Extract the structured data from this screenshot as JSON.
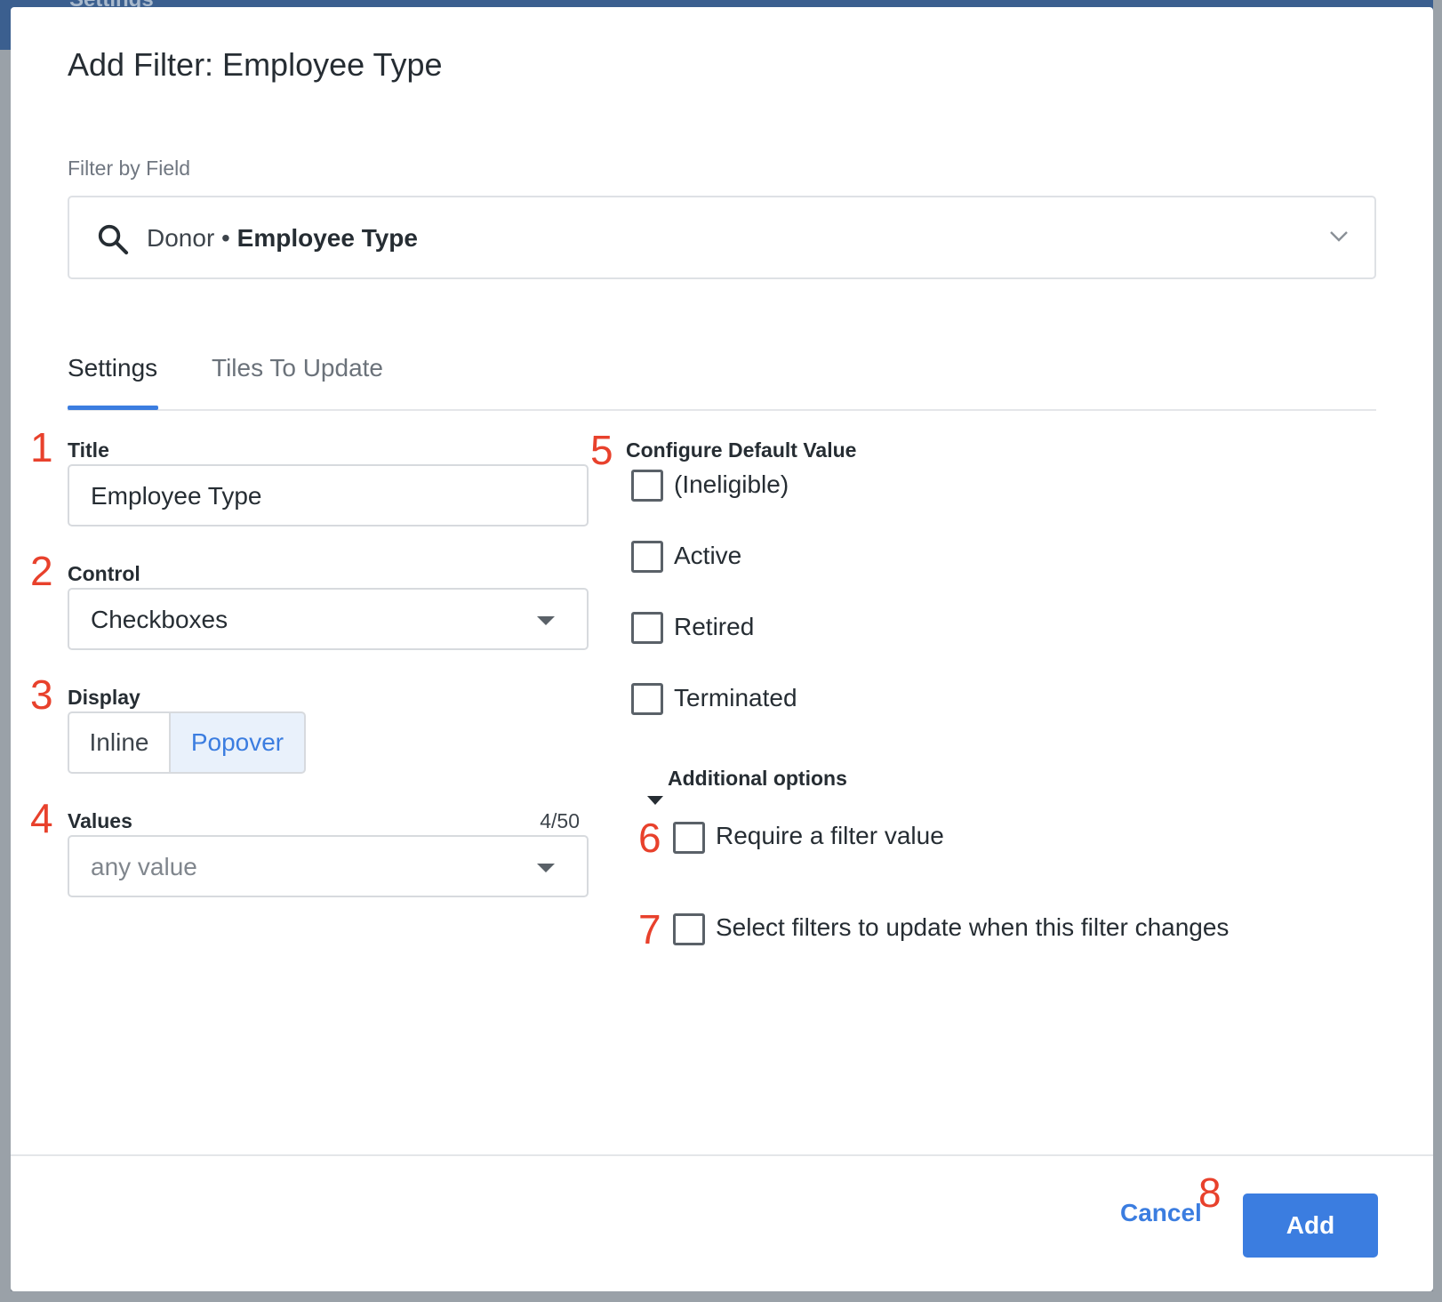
{
  "background": {
    "header_text": "Settings"
  },
  "dialog": {
    "title": "Add Filter: Employee Type",
    "filter_by_field": {
      "label": "Filter by Field",
      "prefix": "Donor",
      "separator": "•",
      "field": "Employee Type"
    },
    "tabs": [
      {
        "label": "Settings",
        "active": true
      },
      {
        "label": "Tiles To Update",
        "active": false
      }
    ],
    "annotations": [
      "1",
      "2",
      "3",
      "4",
      "5",
      "6",
      "7",
      "8"
    ],
    "title_field": {
      "label": "Title",
      "value": "Employee Type"
    },
    "control_field": {
      "label": "Control",
      "value": "Checkboxes"
    },
    "display_field": {
      "label": "Display",
      "options": [
        "Inline",
        "Popover"
      ],
      "selected": "Popover"
    },
    "values_field": {
      "label": "Values",
      "counter": "4/50",
      "placeholder": "any value"
    },
    "default_value": {
      "label": "Configure Default Value",
      "options": [
        {
          "label": "(Ineligible)",
          "checked": false
        },
        {
          "label": "Active",
          "checked": false
        },
        {
          "label": "Retired",
          "checked": false
        },
        {
          "label": "Terminated",
          "checked": false
        }
      ]
    },
    "additional_options": {
      "label": "Additional options",
      "expanded": true,
      "require_value": {
        "label": "Require a filter value",
        "checked": false
      },
      "select_filters": {
        "label": "Select filters to update when this filter changes",
        "checked": false
      }
    },
    "footer": {
      "cancel_label": "Cancel",
      "add_label": "Add"
    }
  },
  "colors": {
    "accent": "#3b7de0",
    "annotation": "#e8412c",
    "header": "#3b5f8f"
  }
}
